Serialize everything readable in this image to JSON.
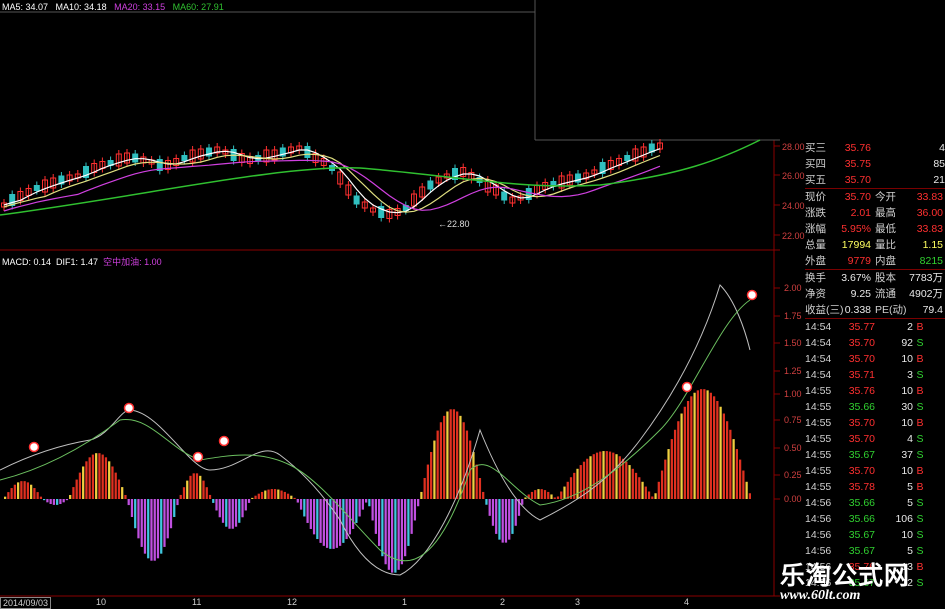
{
  "ma_header": {
    "ma5": "MA5: 34.07",
    "ma10": "MA10: 34.18",
    "ma20": "MA20: 33.15",
    "ma60": "MA60: 27.91",
    "colors": {
      "ma5": "#ffffff",
      "ma10": "#ffffff",
      "ma20": "#d040e0",
      "ma60": "#30c030"
    }
  },
  "macd_header": {
    "macd": "MACD: 0.14",
    "dif1": "DIF1: 1.47",
    "signal": "空中加油: 1.00"
  },
  "price_axis": {
    "labels": [
      "28.00",
      "26.00",
      "24.00",
      "22.00"
    ],
    "low_marker": "22.80"
  },
  "macd_axis": {
    "labels": [
      "2.00",
      "1.75",
      "1.50",
      "1.25",
      "1.00",
      "0.75",
      "0.50",
      "0.25",
      "0.00"
    ]
  },
  "x_axis": {
    "start_date": "2014/09/03",
    "month_labels": [
      "10",
      "11",
      "12",
      "1",
      "2",
      "3",
      "4"
    ]
  },
  "order_book": [
    {
      "label": "买三",
      "price": "35.76",
      "qty": "4"
    },
    {
      "label": "买四",
      "price": "35.75",
      "qty": "85"
    },
    {
      "label": "买五",
      "price": "35.70",
      "qty": "21"
    }
  ],
  "quote": [
    {
      "l1": "现价",
      "v1": "35.70",
      "l2": "今开",
      "v2": "33.83"
    },
    {
      "l1": "涨跌",
      "v1": "2.01",
      "l2": "最高",
      "v2": "36.00"
    },
    {
      "l1": "涨幅",
      "v1": "5.95%",
      "l2": "最低",
      "v2": "33.83"
    },
    {
      "l1": "总量",
      "v1": "17994",
      "l2": "量比",
      "v2": "1.15"
    },
    {
      "l1": "外盘",
      "v1": "9779",
      "l2": "内盘",
      "v2": "8215"
    }
  ],
  "stats": [
    {
      "l1": "换手",
      "v1": "3.67%",
      "l2": "股本",
      "v2": "7783万"
    },
    {
      "l1": "净资",
      "v1": "9.25",
      "l2": "流通",
      "v2": "4902万"
    },
    {
      "l1": "收益(三)",
      "v1": "0.338",
      "l2": "PE(动)",
      "v2": "79.4"
    }
  ],
  "ticks": [
    {
      "time": "14:54",
      "price": "35.77",
      "vol": "2",
      "side": "B"
    },
    {
      "time": "14:54",
      "price": "35.70",
      "vol": "92",
      "side": "S"
    },
    {
      "time": "14:54",
      "price": "35.70",
      "vol": "10",
      "side": "B"
    },
    {
      "time": "14:54",
      "price": "35.71",
      "vol": "3",
      "side": "S"
    },
    {
      "time": "14:55",
      "price": "35.76",
      "vol": "10",
      "side": "B"
    },
    {
      "time": "14:55",
      "price": "35.66",
      "vol": "30",
      "side": "S"
    },
    {
      "time": "14:55",
      "price": "35.70",
      "vol": "10",
      "side": "B"
    },
    {
      "time": "14:55",
      "price": "35.70",
      "vol": "4",
      "side": "S"
    },
    {
      "time": "14:55",
      "price": "35.67",
      "vol": "37",
      "side": "S"
    },
    {
      "time": "14:55",
      "price": "35.70",
      "vol": "10",
      "side": "B"
    },
    {
      "time": "14:55",
      "price": "35.78",
      "vol": "5",
      "side": "B"
    },
    {
      "time": "14:56",
      "price": "35.66",
      "vol": "5",
      "side": "S"
    },
    {
      "time": "14:56",
      "price": "35.66",
      "vol": "106",
      "side": "S"
    },
    {
      "time": "14:56",
      "price": "35.67",
      "vol": "10",
      "side": "S"
    },
    {
      "time": "14:56",
      "price": "35.67",
      "vol": "5",
      "side": "S"
    },
    {
      "time": "14:56",
      "price": "35.76",
      "vol": "13",
      "side": "B"
    },
    {
      "time": "14:56",
      "price": "35.67",
      "vol": "12",
      "side": "S"
    }
  ],
  "watermark": {
    "title": "乐淘公式网",
    "url": "www.60lt.com"
  },
  "colors": {
    "up": "#ff3030",
    "down": "#30c0c0",
    "buy_tag": "#ff3030",
    "sell_tag": "#30d030",
    "grid_red": "#8a0000",
    "hist_red": "#e03020",
    "hist_yellow": "#f0d040",
    "hist_cyan": "#40c8e0",
    "hist_magenta": "#c050e0"
  }
}
